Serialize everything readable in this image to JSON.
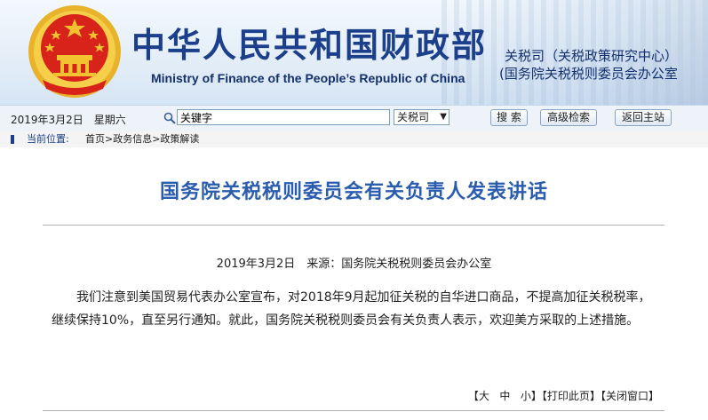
{
  "header": {
    "title_cn": "中华人民共和国财政部",
    "title_en": "Ministry of Finance of the People’s Republic of China",
    "department_line1": "关税司（关税政策研究中心）",
    "department_line2": "(国务院关税税则委员会办公室"
  },
  "toolbar": {
    "date_weekday": "2019年3月2日　星期六",
    "search_value": "关键字",
    "scope_value": "关税司",
    "search_button": "搜 索",
    "advanced_search_button": "高级检索",
    "home_button": "返回主站"
  },
  "breadcrumb": {
    "label": "当前位置:",
    "path": "首页>政务信息>政策解读"
  },
  "article": {
    "title": "国务院关税税则委员会有关负责人发表讲话",
    "meta": "2019年3月2日　来源：国务院关税税则委员会办公室",
    "body": "我们注意到美国贸易代表办公室宣布，对2018年9月起加征关税的自华进口商品，不提高加征关税税率，继续保持10%，直至另行通知。就此，国务院关税税则委员会有关负责人表示，欢迎美方采取的上述措施。"
  },
  "page_tools": {
    "font_large": "大",
    "font_medium": "中",
    "font_small": "小",
    "print": "打印此页",
    "close": "关闭窗口"
  },
  "colors": {
    "brand_blue": "#1b3f8b",
    "title_blue": "#2a5db0",
    "emblem_red": "#d7231a",
    "emblem_gold": "#f2c230"
  }
}
